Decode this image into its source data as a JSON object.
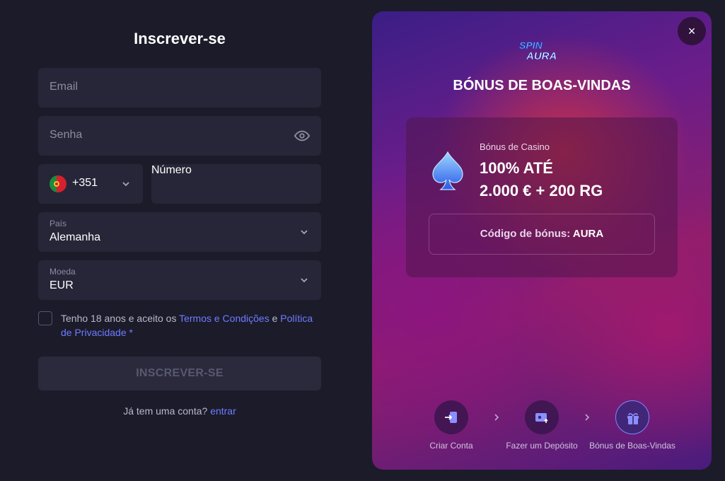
{
  "form": {
    "title": "Inscrever-se",
    "email_placeholder": "Email",
    "password_placeholder": "Senha",
    "phone_prefix": "+351",
    "phone_placeholder": "Número",
    "country_label": "País",
    "country_value": "Alemanha",
    "currency_label": "Moeda",
    "currency_value": "EUR",
    "terms_prefix": "Tenho 18 anos e aceito os ",
    "terms_link": "Termos e Condições",
    "terms_and": " e ",
    "privacy_link": "Política de Privacidade",
    "required_mark": " *",
    "submit_label": "INSCREVER-SE",
    "login_prompt": "Já tem uma conta? ",
    "login_link": "entrar"
  },
  "promo": {
    "close_label": "×",
    "logo_alt": "Spin Aura",
    "title": "BÓNUS DE BOAS-VINDAS",
    "bonus_subtitle": "Bónus de Casino",
    "bonus_line1": "100% ATÉ",
    "bonus_line2": "2.000 € + 200 RG",
    "code_label": "Código de bónus: ",
    "code_value": "AURA",
    "steps": [
      {
        "label": "Criar Conta",
        "icon": "enter-icon"
      },
      {
        "label": "Fazer um Depósito",
        "icon": "wallet-icon"
      },
      {
        "label": "Bónus de Boas-Vindas",
        "icon": "gift-icon",
        "active": true
      }
    ]
  },
  "colors": {
    "background": "#1b1b2a",
    "field": "#262638",
    "link": "#6f7cff",
    "active_step_border": "#7b86ff"
  }
}
